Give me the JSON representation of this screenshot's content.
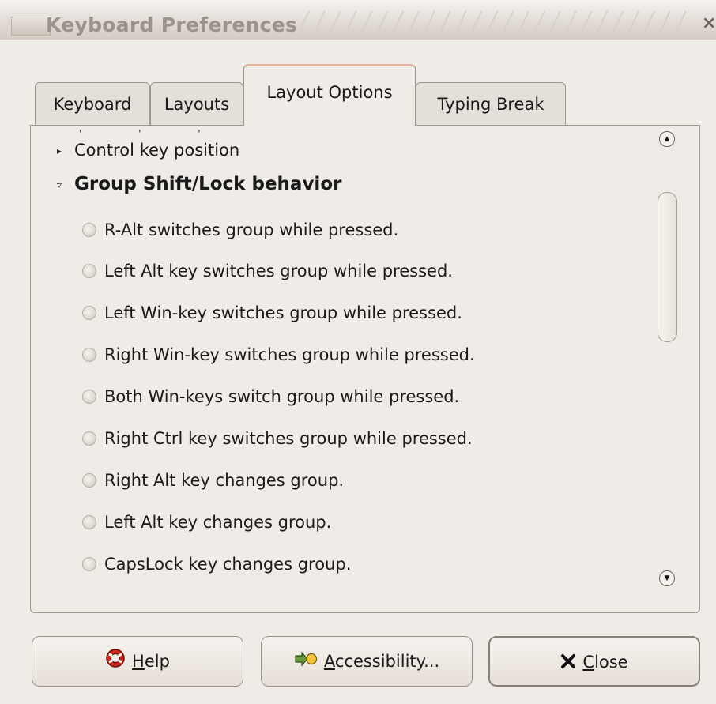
{
  "window": {
    "title": "Keyboard Preferences",
    "close_glyph": "×"
  },
  "tabs": [
    {
      "label": "Keyboard"
    },
    {
      "label": "Layouts"
    },
    {
      "label": "Layout Options"
    },
    {
      "label": "Typing Break"
    }
  ],
  "active_tab": "Layout Options",
  "tree": {
    "collapsed_item": "Control key position",
    "expanded_item": "Group Shift/Lock behavior",
    "options": [
      "R-Alt switches group while pressed.",
      "Left Alt key switches group while pressed.",
      "Left Win-key switches group while pressed.",
      "Right Win-key switches group while pressed.",
      "Both Win-keys switch group while pressed.",
      "Right Ctrl key switches group while pressed.",
      "Right Alt key changes group.",
      "Left Alt key changes group.",
      "CapsLock key changes group."
    ]
  },
  "buttons": {
    "help": {
      "mnemonic": "H",
      "rest": "elp",
      "icon": "lifebuoy-icon"
    },
    "accessibility": {
      "mnemonic": "A",
      "rest": "ccessibility...",
      "icon": "accessibility-icon"
    },
    "close": {
      "mnemonic": "C",
      "rest": "lose",
      "icon": "x-icon"
    }
  }
}
